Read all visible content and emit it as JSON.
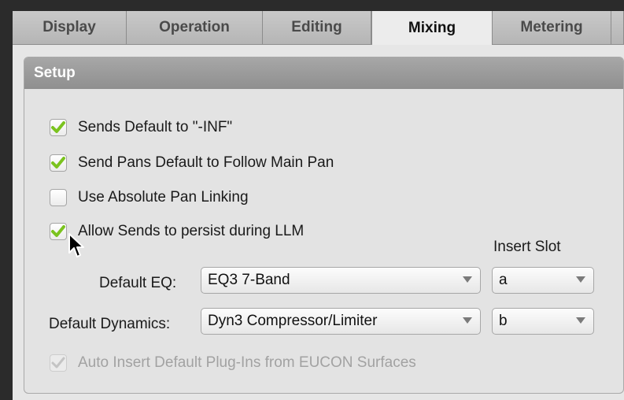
{
  "tabs": [
    {
      "label": "Display",
      "active": false
    },
    {
      "label": "Operation",
      "active": false
    },
    {
      "label": "Editing",
      "active": false
    },
    {
      "label": "Mixing",
      "active": true
    },
    {
      "label": "Metering",
      "active": false
    }
  ],
  "setup": {
    "title": "Setup",
    "options": [
      {
        "label": "Sends Default to \"-INF\"",
        "checked": true,
        "enabled": true
      },
      {
        "label": "Send Pans Default to Follow Main Pan",
        "checked": true,
        "enabled": true
      },
      {
        "label": "Use Absolute Pan Linking",
        "checked": false,
        "enabled": true
      },
      {
        "label": "Allow Sends to persist during LLM",
        "checked": true,
        "enabled": true
      }
    ],
    "insert_slot_label": "Insert Slot",
    "default_eq": {
      "label": "Default EQ:",
      "value": "EQ3 7-Band",
      "slot": "a"
    },
    "default_dynamics": {
      "label": "Default Dynamics:",
      "value": "Dyn3 Compressor/Limiter",
      "slot": "b"
    },
    "auto_insert": {
      "label": "Auto Insert Default Plug-Ins from EUCON Surfaces",
      "checked": true,
      "enabled": false
    }
  },
  "colors": {
    "check_green": "#7bc31f",
    "header_gray": "#999999"
  }
}
